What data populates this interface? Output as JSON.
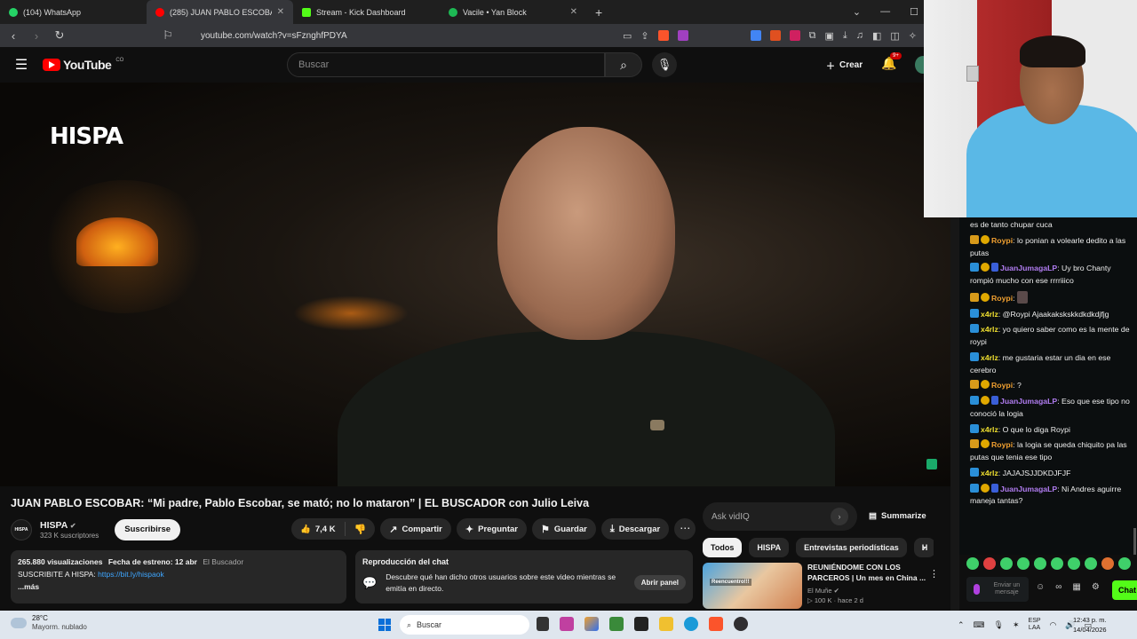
{
  "browser": {
    "tabs": [
      {
        "label": "(104) WhatsApp",
        "color": "#25d366"
      },
      {
        "label": "(285) JUAN PABLO ESCOBAR:",
        "color": "#ff0000",
        "active": true
      },
      {
        "label": "Stream - Kick Dashboard",
        "color": "#53fc18"
      },
      {
        "label": "Vacile • Yan Block",
        "color": "#1db954"
      }
    ],
    "new_tab": "+",
    "url": "youtube.com/watch?v=sFznghfPDYA"
  },
  "youtube": {
    "logo_text": "YouTube",
    "logo_region": "CO",
    "search_placeholder": "Buscar",
    "create_label": "Crear",
    "notif_badge": "9+",
    "video_overlay_logo": "HISPA",
    "title": "JUAN PABLO ESCOBAR: “Mi padre, Pablo Escobar, se mató; no lo mataron” | EL BUSCADOR con Julio Leiva",
    "channel": {
      "avatar_text": "HISPA",
      "name": "HISPA",
      "verified": "✔",
      "subs": "323 K suscriptores",
      "subscribe_label": "Suscribirse"
    },
    "actions": {
      "likes": "7,4 K",
      "share": "Compartir",
      "ask": "Preguntar",
      "save": "Guardar",
      "download": "Descargar",
      "more": "⋯"
    },
    "description": {
      "views": "265.880 visualizaciones",
      "premiere": "Fecha de estreno: 12 abr",
      "tag": "El Buscador",
      "line2_prefix": "SUSCRIBITE A HISPA: ",
      "link": "https://bit.ly/hispaok",
      "more": "...más"
    },
    "chat_replay": {
      "title": "Reproducción del chat",
      "text": "Descubre qué han dicho otros usuarios sobre este video mientras se emitía en directo.",
      "button": "Abrir panel"
    },
    "vidiq": {
      "placeholder": "Ask vidIQ",
      "summarize": "Summarize"
    },
    "chips": [
      "Todos",
      "HISPA",
      "Entrevistas periodísticas",
      "H"
    ],
    "recommendation": {
      "title": "REUNIÉNDOME CON LOS PARCEROS | Un mes en China ...",
      "channel": "El Muñe",
      "views": "100 K",
      "age": "hace 2 d",
      "thumb_text": "Reencuentro!!!"
    }
  },
  "kick_chat": {
    "messages": [
      {
        "badges": [],
        "user": "",
        "text": "es de tanto chupar cuca",
        "color": "#ffffff"
      },
      {
        "badges": [
          "og",
          "gold"
        ],
        "user": "Roypi",
        "text": "lo ponian a volearle dedito a las putas",
        "color": "#f0a030"
      },
      {
        "badges": [
          "sub",
          "gold",
          "mod"
        ],
        "user": "JuanJumagaLP",
        "text": "Uy bro Chanty rompió mucho con ese rrrriiico",
        "color": "#b07cf0"
      },
      {
        "badges": [
          "og",
          "gold"
        ],
        "user": "Roypi",
        "text": "",
        "color": "#f0a030",
        "emote": true
      },
      {
        "badges": [
          "sub"
        ],
        "user": "x4rlz",
        "text": "@Roypi Ajaakakskskkdkdkdjfjg",
        "color": "#f0e030"
      },
      {
        "badges": [
          "sub"
        ],
        "user": "x4rlz",
        "text": "yo quiero saber como es la mente de roypi",
        "color": "#f0e030"
      },
      {
        "badges": [
          "sub"
        ],
        "user": "x4rlz",
        "text": "me gustaria estar un dia en ese cerebro",
        "color": "#f0e030"
      },
      {
        "badges": [
          "og",
          "gold"
        ],
        "user": "Roypi",
        "text": "?",
        "color": "#f0a030"
      },
      {
        "badges": [
          "sub",
          "gold",
          "mod"
        ],
        "user": "JuanJumagaLP",
        "text": "Eso que ese tipo no conoció la logia",
        "color": "#b07cf0"
      },
      {
        "badges": [
          "sub"
        ],
        "user": "x4rlz",
        "text": "O que lo diga Roypi",
        "color": "#f0e030"
      },
      {
        "badges": [
          "og",
          "gold"
        ],
        "user": "Roypi",
        "text": "la logia se queda chiquito pa las putas que tenia ese tipo",
        "color": "#f0a030"
      },
      {
        "badges": [
          "sub"
        ],
        "user": "x4rlz",
        "text": "JAJAJSJJDKDJFJF",
        "color": "#f0e030"
      },
      {
        "badges": [
          "sub",
          "gold",
          "mod"
        ],
        "user": "JuanJumagaLP",
        "text": "Ni Andres aguirre maneja tantas?",
        "color": "#b07cf0"
      }
    ],
    "input_placeholder": "Enviar un mensaje",
    "chat_button": "Chat"
  },
  "taskbar": {
    "temp": "28°C",
    "weather": "Mayorm. nublado",
    "search": "Buscar",
    "lang1": "ESP",
    "lang2": "LAA",
    "time": "12:43 p. m.",
    "date": "14/04/2026"
  }
}
